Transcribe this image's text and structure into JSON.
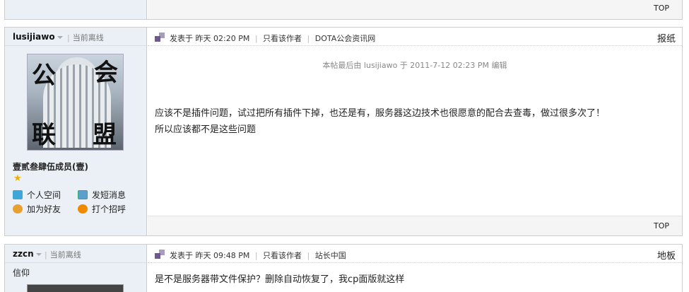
{
  "top_post": {
    "top_label": "TOP"
  },
  "posts": [
    {
      "username": "lusijiawo",
      "status": "当前离线",
      "rank": "壹贰叁肆伍成员(壹)",
      "avatar_text": [
        "公",
        "会",
        "联",
        "盟"
      ],
      "actions": [
        "个人空间",
        "发短消息",
        "加为好友",
        "打个招呼"
      ],
      "posted": "发表于 昨天 02:20 PM",
      "author_only": "只看该作者",
      "tag": "DOTA公会资讯网",
      "floor": "报纸",
      "edited": "本帖最后由 lusijiawo 于 2011-7-12 02:23 PM 编辑",
      "body_line1": "应该不是插件问题，试过把所有插件下掉，也还是有，服务器这边技术也很愿意的配合去查毒，做过很多次了！",
      "body_line2": "所以应该都不是这些问题",
      "top_label": "TOP"
    },
    {
      "username": "zzcn",
      "status": "当前离线",
      "user_title": "信仰",
      "posted": "发表于 昨天 09:48 PM",
      "author_only": "只看该作者",
      "tag": "站长中国",
      "floor": "地板",
      "body_line1": "是不是服务器带文件保护？删除自动恢复了，我cp面版就这样"
    }
  ],
  "icons": [
    "home-icon",
    "message-icon",
    "add-friend-icon",
    "greet-icon",
    "star-icon",
    "post-icon"
  ]
}
